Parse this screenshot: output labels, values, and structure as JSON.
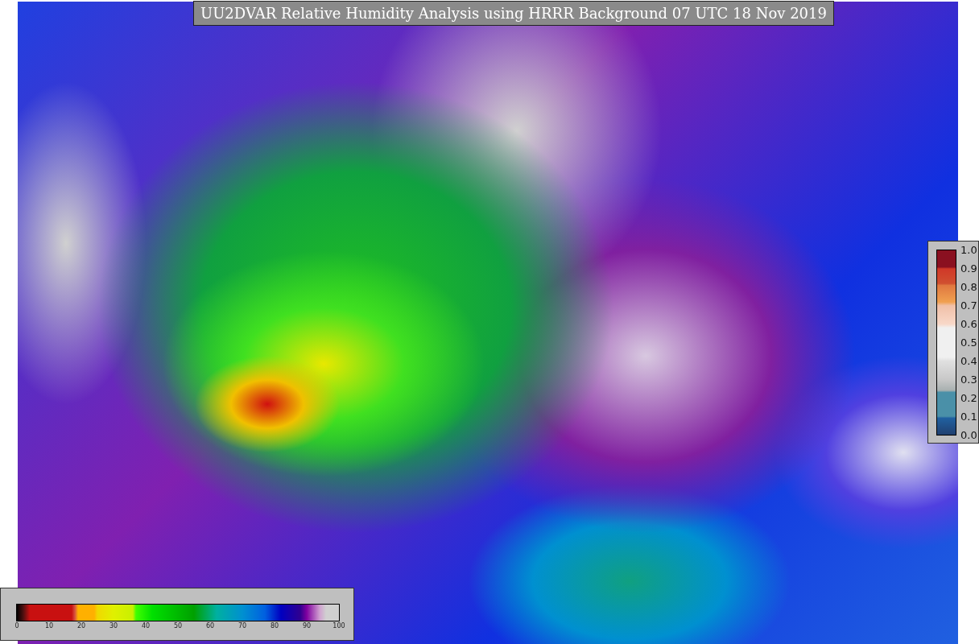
{
  "title": "UU2DVAR Relative Humidity Analysis using HRRR Background 07 UTC 18 Nov 2019",
  "rh_colorbar": {
    "ticks": [
      "0",
      "10",
      "20",
      "30",
      "40",
      "50",
      "60",
      "70",
      "80",
      "90",
      "100"
    ]
  },
  "obs_colorbar": {
    "ticks": [
      "1.0",
      "0.9",
      "0.8",
      "0.7",
      "0.6",
      "0.5",
      "0.4",
      "0.3",
      "0.2",
      "0.1",
      "0.0"
    ]
  }
}
